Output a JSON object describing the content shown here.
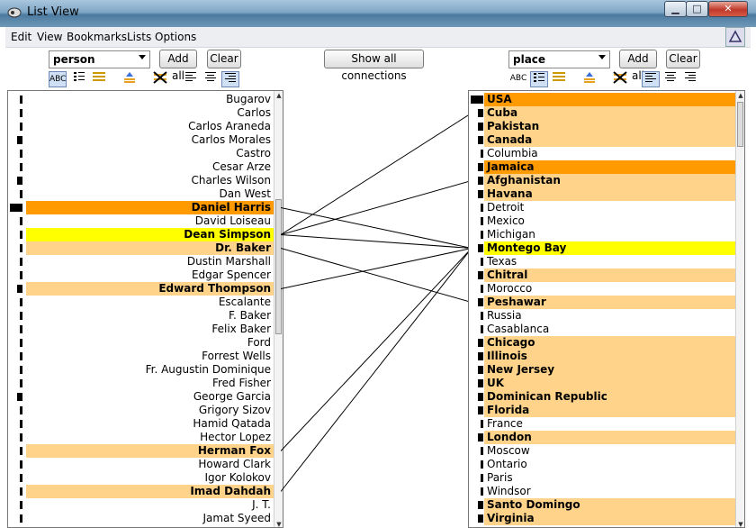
{
  "window": {
    "title": "List View"
  },
  "window_buttons": {
    "minimize": "▁",
    "maximize": "□",
    "close": "✕"
  },
  "menu": [
    "Edit",
    "View",
    "Bookmarks",
    "Lists",
    "Options"
  ],
  "show_all_label": "Show all connections",
  "left": {
    "type_selected": "person",
    "add_all": "Add all",
    "clear": "Clear",
    "rows": [
      {
        "label": "Bugarov",
        "strength": 1,
        "hl": "",
        "bold": false
      },
      {
        "label": "Carlos",
        "strength": 1,
        "hl": "",
        "bold": false
      },
      {
        "label": "Carlos Araneda",
        "strength": 1,
        "hl": "",
        "bold": false
      },
      {
        "label": "Carlos Morales",
        "strength": 2,
        "hl": "",
        "bold": false
      },
      {
        "label": "Castro",
        "strength": 1,
        "hl": "",
        "bold": false
      },
      {
        "label": "Cesar Arze",
        "strength": 1,
        "hl": "",
        "bold": false
      },
      {
        "label": "Charles Wilson",
        "strength": 2,
        "hl": "",
        "bold": false
      },
      {
        "label": "Dan West",
        "strength": 1,
        "hl": "",
        "bold": false
      },
      {
        "label": "Daniel Harris",
        "strength": 4,
        "hl": "orange",
        "bold": true
      },
      {
        "label": "David Loiseau",
        "strength": 1,
        "hl": "",
        "bold": false
      },
      {
        "label": "Dean Simpson",
        "strength": 1,
        "hl": "yellow",
        "bold": true
      },
      {
        "label": "Dr. Baker",
        "strength": 1,
        "hl": "light",
        "bold": true
      },
      {
        "label": "Dustin Marshall",
        "strength": 1,
        "hl": "",
        "bold": false
      },
      {
        "label": "Edgar Spencer",
        "strength": 1,
        "hl": "",
        "bold": false
      },
      {
        "label": "Edward Thompson",
        "strength": 2,
        "hl": "light",
        "bold": true
      },
      {
        "label": "Escalante",
        "strength": 1,
        "hl": "",
        "bold": false
      },
      {
        "label": "F. Baker",
        "strength": 1,
        "hl": "",
        "bold": false
      },
      {
        "label": "Felix Baker",
        "strength": 1,
        "hl": "",
        "bold": false
      },
      {
        "label": "Ford",
        "strength": 1,
        "hl": "",
        "bold": false
      },
      {
        "label": "Forrest Wells",
        "strength": 1,
        "hl": "",
        "bold": false
      },
      {
        "label": "Fr. Augustin Dominique",
        "strength": 1,
        "hl": "",
        "bold": false
      },
      {
        "label": "Fred Fisher",
        "strength": 1,
        "hl": "",
        "bold": false
      },
      {
        "label": "George Garcia",
        "strength": 2,
        "hl": "",
        "bold": false
      },
      {
        "label": "Grigory Sizov",
        "strength": 1,
        "hl": "",
        "bold": false
      },
      {
        "label": "Hamid Qatada",
        "strength": 1,
        "hl": "",
        "bold": false
      },
      {
        "label": "Hector Lopez",
        "strength": 1,
        "hl": "",
        "bold": false
      },
      {
        "label": "Herman Fox",
        "strength": 1,
        "hl": "light",
        "bold": true
      },
      {
        "label": "Howard Clark",
        "strength": 1,
        "hl": "",
        "bold": false
      },
      {
        "label": "Igor Kolokov",
        "strength": 1,
        "hl": "",
        "bold": false
      },
      {
        "label": "Imad Dahdah",
        "strength": 1,
        "hl": "light",
        "bold": true
      },
      {
        "label": "J. T.",
        "strength": 1,
        "hl": "",
        "bold": false
      },
      {
        "label": "Jamat Syeed",
        "strength": 1,
        "hl": "",
        "bold": false
      }
    ]
  },
  "right": {
    "type_selected": "place",
    "add_all": "Add all",
    "clear": "Clear",
    "rows": [
      {
        "label": "USA",
        "strength": 4,
        "hl": "orange",
        "bold": true
      },
      {
        "label": "Cuba",
        "strength": 2,
        "hl": "light",
        "bold": true
      },
      {
        "label": "Pakistan",
        "strength": 2,
        "hl": "light",
        "bold": true
      },
      {
        "label": "Canada",
        "strength": 2,
        "hl": "light",
        "bold": true
      },
      {
        "label": "Columbia",
        "strength": 1,
        "hl": "",
        "bold": false
      },
      {
        "label": "Jamaica",
        "strength": 2,
        "hl": "orange",
        "bold": true
      },
      {
        "label": "Afghanistan",
        "strength": 2,
        "hl": "light",
        "bold": true
      },
      {
        "label": "Havana",
        "strength": 2,
        "hl": "light",
        "bold": true
      },
      {
        "label": "Detroit",
        "strength": 1,
        "hl": "",
        "bold": false
      },
      {
        "label": "Mexico",
        "strength": 1,
        "hl": "",
        "bold": false
      },
      {
        "label": "Michigan",
        "strength": 1,
        "hl": "",
        "bold": false
      },
      {
        "label": "Montego Bay",
        "strength": 2,
        "hl": "yellow",
        "bold": true
      },
      {
        "label": "Texas",
        "strength": 1,
        "hl": "",
        "bold": false
      },
      {
        "label": "Chitral",
        "strength": 2,
        "hl": "light",
        "bold": true
      },
      {
        "label": "Morocco",
        "strength": 1,
        "hl": "",
        "bold": false
      },
      {
        "label": "Peshawar",
        "strength": 2,
        "hl": "light",
        "bold": true
      },
      {
        "label": "Russia",
        "strength": 1,
        "hl": "",
        "bold": false
      },
      {
        "label": "Casablanca",
        "strength": 1,
        "hl": "",
        "bold": false
      },
      {
        "label": "Chicago",
        "strength": 2,
        "hl": "light",
        "bold": true
      },
      {
        "label": "Illinois",
        "strength": 2,
        "hl": "light",
        "bold": true
      },
      {
        "label": "New Jersey",
        "strength": 2,
        "hl": "light",
        "bold": true
      },
      {
        "label": "UK",
        "strength": 2,
        "hl": "light",
        "bold": true
      },
      {
        "label": "Dominican Republic",
        "strength": 2,
        "hl": "light",
        "bold": true
      },
      {
        "label": "Florida",
        "strength": 2,
        "hl": "light",
        "bold": true
      },
      {
        "label": "France",
        "strength": 1,
        "hl": "",
        "bold": false
      },
      {
        "label": "London",
        "strength": 2,
        "hl": "light",
        "bold": true
      },
      {
        "label": "Moscow",
        "strength": 1,
        "hl": "",
        "bold": false
      },
      {
        "label": "Ontario",
        "strength": 1,
        "hl": "",
        "bold": false
      },
      {
        "label": "Paris",
        "strength": 1,
        "hl": "",
        "bold": false
      },
      {
        "label": "Windsor",
        "strength": 1,
        "hl": "",
        "bold": false
      },
      {
        "label": "Santo Domingo",
        "strength": 2,
        "hl": "light",
        "bold": true
      },
      {
        "label": "Virginia",
        "strength": 2,
        "hl": "light",
        "bold": true
      }
    ]
  },
  "connections": [
    {
      "from": "Daniel Harris",
      "to": "Montego Bay"
    },
    {
      "from": "Dean Simpson",
      "to": "Montego Bay"
    },
    {
      "from": "Dean Simpson",
      "to": "Cuba"
    },
    {
      "from": "Dean Simpson",
      "to": "Afghanistan"
    },
    {
      "from": "Dr. Baker",
      "to": "Peshawar"
    },
    {
      "from": "Edward Thompson",
      "to": "Montego Bay"
    },
    {
      "from": "Herman Fox",
      "to": "Montego Bay"
    },
    {
      "from": "Imad Dahdah",
      "to": "Montego Bay"
    }
  ],
  "colors": {
    "orange": "#ff9a00",
    "light": "#ffd38a",
    "yellow": "#ffff00"
  }
}
